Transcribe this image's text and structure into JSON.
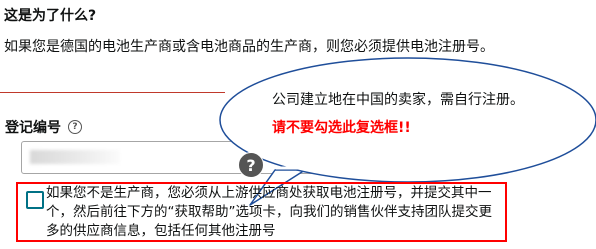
{
  "section": {
    "heading": "这是为了什么?",
    "description": "如果您是德国的电池生产商或含电池商品的生产商，则您必须提供电池注册号。"
  },
  "registration": {
    "label": "登记编号",
    "info_icon": "info-circle-icon",
    "input_value": ""
  },
  "callout": {
    "text": "公司建立地在中国的卖家，需自行注册。",
    "warning": "请不要勾选此复选框!!",
    "warning_color": "#ff0000"
  },
  "help_badge": {
    "icon": "question-mark-icon",
    "glyph": "?"
  },
  "option": {
    "checked": false,
    "label": "如果您不是生产商，您必须从上游供应商处获取电池注册号，并提交其中一个，然后前往下方的“获取帮助”选项卡，向我们的销售伙伴支持团队提交更多的供应商信息，包括任何其他注册号",
    "border_color": "#ff0000",
    "checkbox_color": "#007185"
  }
}
